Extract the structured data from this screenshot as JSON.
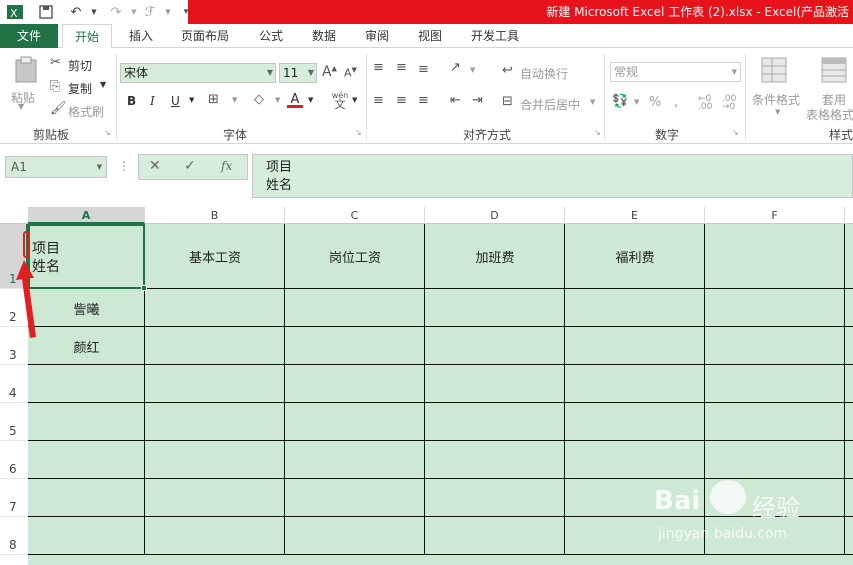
{
  "title_bar": {
    "text": "新建 Microsoft Excel 工作表 (2).xlsx -   Excel(产品激活"
  },
  "tabs": [
    "文件",
    "开始",
    "插入",
    "页面布局",
    "公式",
    "数据",
    "审阅",
    "视图",
    "开发工具"
  ],
  "ribbon": {
    "clipboard": {
      "paste": "粘贴",
      "cut": "剪切",
      "copy": "复制",
      "format_painter": "格式刷",
      "group_label": "剪贴板"
    },
    "font": {
      "font_name": "宋体",
      "font_size": "11",
      "bold": "B",
      "italic": "I",
      "underline": "U",
      "wen": "wén",
      "wen_char": "文",
      "group_label": "字体"
    },
    "alignment": {
      "wrap_text": "自动换行",
      "merge_center": "合并后居中",
      "group_label": "对齐方式"
    },
    "number": {
      "format": "常规",
      "percent": "%",
      "group_label": "数字"
    },
    "styles": {
      "conditional": "条件格式",
      "table_format_1": "套用",
      "table_format_2": "表格格式",
      "group_label": "样式"
    }
  },
  "formula_bar": {
    "name_box": "A1",
    "fx": "fx",
    "line1": "项目",
    "line2": "姓名"
  },
  "columns": [
    "A",
    "B",
    "C",
    "D",
    "E",
    "F"
  ],
  "rows": [
    "1",
    "2",
    "3",
    "4",
    "5",
    "6",
    "7",
    "8"
  ],
  "cells": {
    "A1_line1": "项目",
    "A1_line2": "姓名",
    "B1": "基本工资",
    "C1": "岗位工资",
    "D1": "加班费",
    "E1": "福利费",
    "A2": "訾曦",
    "A3": "颜红"
  },
  "watermark": {
    "brand": "Bai",
    "brand_cn": "经验",
    "url": "jingyan.baidu.com"
  },
  "colors": {
    "excel_green": "#217346",
    "title_red": "#e8121a",
    "cell_fill": "#cde8d3",
    "annotation_red": "#e02020"
  }
}
